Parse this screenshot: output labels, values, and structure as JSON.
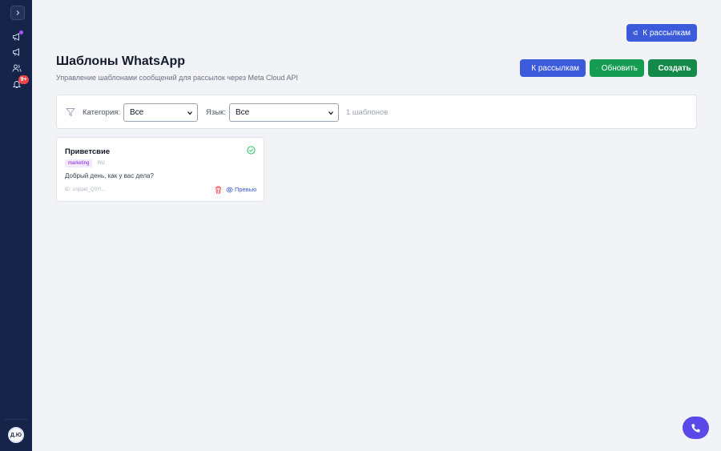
{
  "sidebar": {
    "notifications_badge": "9+",
    "avatar_initials": "Д.Ю"
  },
  "header": {
    "top_button_label": "К рассылкам",
    "title": "Шаблоны WhatsApp",
    "subtitle": "Управление шаблонами сообщений для рассылок через Meta Cloud API",
    "actions": {
      "back_label": "К рассылкам",
      "refresh_label": "Обновить",
      "create_label": "Создать"
    }
  },
  "filters": {
    "category_label": "Категория:",
    "category_value": "Все",
    "language_label": "Язык:",
    "language_value": "Все",
    "count_text": "1 шаблонов"
  },
  "templates": [
    {
      "name": "Приветсвие",
      "category": "marketing",
      "language": "RU",
      "body": "Добрый день, как у вас дела?",
      "id_text": "ID: snippet_Q3Yt...",
      "preview_label": "Превью",
      "status": "approved"
    }
  ],
  "colors": {
    "sidebar": "#17244a",
    "primary": "#3b5bdb",
    "success": "#179c53",
    "fab": "#5b48e8"
  }
}
